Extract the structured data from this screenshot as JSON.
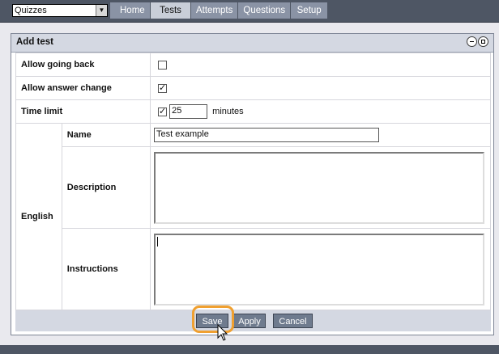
{
  "module_select": {
    "value": "Quizzes"
  },
  "nav_tabs": [
    "Home",
    "Tests",
    "Attempts",
    "Questions",
    "Setup"
  ],
  "panel": {
    "title": "Add test"
  },
  "form": {
    "allow_going_back": {
      "label": "Allow going back",
      "checked": false
    },
    "allow_answer_change": {
      "label": "Allow answer change",
      "checked": true
    },
    "time_limit": {
      "label": "Time limit",
      "checked": true,
      "value": "25",
      "unit": "minutes"
    },
    "language": "English",
    "name": {
      "label": "Name",
      "value": "Test example"
    },
    "description": {
      "label": "Description",
      "value": ""
    },
    "instructions": {
      "label": "Instructions",
      "value": ""
    }
  },
  "buttons": {
    "save": "Save",
    "apply": "Apply",
    "cancel": "Cancel"
  },
  "colors": {
    "highlight": "#f0a030",
    "button": "#6f7b8e",
    "topbar": "#4e5664"
  }
}
